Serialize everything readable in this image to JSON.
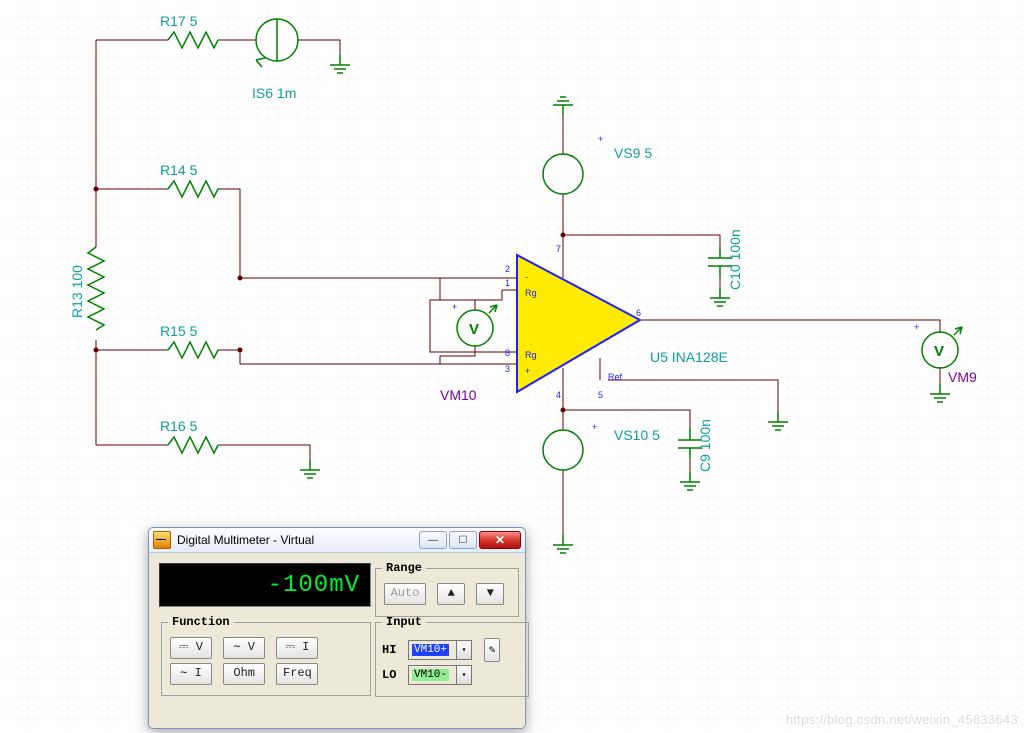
{
  "components": {
    "R17": {
      "label": "R17 5"
    },
    "R14": {
      "label": "R14 5"
    },
    "R15": {
      "label": "R15 5"
    },
    "R16": {
      "label": "R16 5"
    },
    "R13": {
      "label": "R13 100"
    },
    "IS6": {
      "label": "IS6 1m"
    },
    "VS9": {
      "label": "VS9 5"
    },
    "VS10": {
      "label": "VS10 5"
    },
    "C10": {
      "label": "C10 100n"
    },
    "C9": {
      "label": "C9 100n"
    },
    "U5": {
      "label": "U5 INA128E"
    },
    "VM10": {
      "label": "VM10"
    },
    "VM9": {
      "label": "VM9"
    }
  },
  "pins": {
    "p1": "1",
    "p2": "2",
    "p3": "3",
    "p4": "4",
    "p5": "5",
    "p6": "6",
    "p7": "7",
    "p8": "8",
    "rg": "Rg",
    "ref": "Ref",
    "plus": "+",
    "minus": "-"
  },
  "amp_inner_letter": "V",
  "multimeter": {
    "title": "Digital Multimeter - Virtual",
    "reading": "-100mV",
    "groups": {
      "range": "Range",
      "function": "Function",
      "input": "Input"
    },
    "range_buttons": {
      "auto": "Auto",
      "up": "▲",
      "down": "▼"
    },
    "function_buttons": {
      "dcv": "⎓ V",
      "acv": "∼ V",
      "dci": "⎓ I",
      "aci": "∼ I",
      "ohm": "Ohm",
      "freq": "Freq"
    },
    "inputs": {
      "hi_label": "HI",
      "hi_value": "VM10+",
      "lo_label": "LO",
      "lo_value": "VM10-"
    },
    "probe_icon": "✎"
  },
  "tb": {
    "min": "—",
    "max": "☐",
    "close": "✕"
  },
  "watermark": "https://blog.csdn.net/weixin_45633643"
}
